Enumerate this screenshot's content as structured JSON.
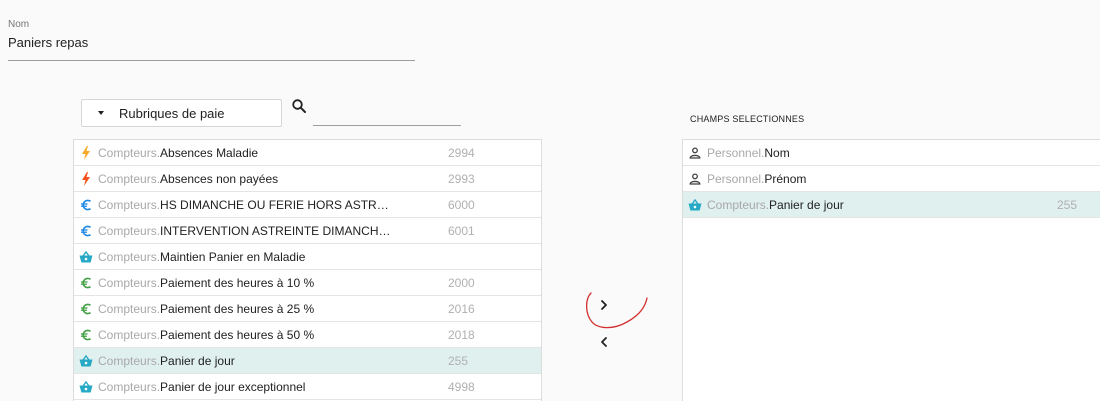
{
  "name_field": {
    "label": "Nom",
    "value": "Paniers repas"
  },
  "category_select": {
    "selected": "Rubriques de paie"
  },
  "search": {
    "placeholder": ""
  },
  "selected_header": "CHAMPS SELECTIONNES",
  "source_list": [
    {
      "icon": "lightning-icon",
      "color": "#f9a825",
      "prefix": "Compteurs.",
      "name": "Absences Maladie",
      "code": "2994",
      "selected": false
    },
    {
      "icon": "lightning-icon",
      "color": "#f4511e",
      "prefix": "Compteurs.",
      "name": "Absences non payées",
      "code": "2993",
      "selected": false
    },
    {
      "icon": "euro-icon",
      "color": "#1e88e5",
      "prefix": "Compteurs.",
      "name": "HS DIMANCHE OU FERIE HORS ASTREI…",
      "code": "6000",
      "selected": false
    },
    {
      "icon": "euro-icon",
      "color": "#1e88e5",
      "prefix": "Compteurs.",
      "name": "INTERVENTION ASTREINTE DIMANCHE …",
      "code": "6001",
      "selected": false
    },
    {
      "icon": "basket-icon",
      "color": "#26a9c5",
      "prefix": "Compteurs.",
      "name": "Maintien Panier en Maladie",
      "code": "",
      "selected": false
    },
    {
      "icon": "euro-icon",
      "color": "#43a047",
      "prefix": "Compteurs.",
      "name": "Paiement des heures à 10 %",
      "code": "2000",
      "selected": false
    },
    {
      "icon": "euro-icon",
      "color": "#43a047",
      "prefix": "Compteurs.",
      "name": "Paiement des heures à 25 %",
      "code": "2016",
      "selected": false
    },
    {
      "icon": "euro-icon",
      "color": "#43a047",
      "prefix": "Compteurs.",
      "name": "Paiement des heures à 50 %",
      "code": "2018",
      "selected": false
    },
    {
      "icon": "basket-icon",
      "color": "#26a9c5",
      "prefix": "Compteurs.",
      "name": "Panier de jour",
      "code": "255",
      "selected": true
    },
    {
      "icon": "basket-icon",
      "color": "#26a9c5",
      "prefix": "Compteurs.",
      "name": "Panier de jour exceptionnel",
      "code": "4998",
      "selected": false
    }
  ],
  "selected_list": [
    {
      "icon": "person-icon",
      "color": "#424242",
      "prefix": "Personnel.",
      "name": "Nom",
      "code": "",
      "selected": false
    },
    {
      "icon": "person-icon",
      "color": "#424242",
      "prefix": "Personnel.",
      "name": "Prénom",
      "code": "",
      "selected": false
    },
    {
      "icon": "basket-icon",
      "color": "#26a9c5",
      "prefix": "Compteurs.",
      "name": "Panier de jour",
      "code": "255",
      "selected": true
    }
  ],
  "transfer": {
    "add_icon": "chevron-right-icon",
    "remove_icon": "chevron-left-icon"
  },
  "colors": {
    "selected_row": "#e0f0ef",
    "annotation": "#d32f2f"
  }
}
